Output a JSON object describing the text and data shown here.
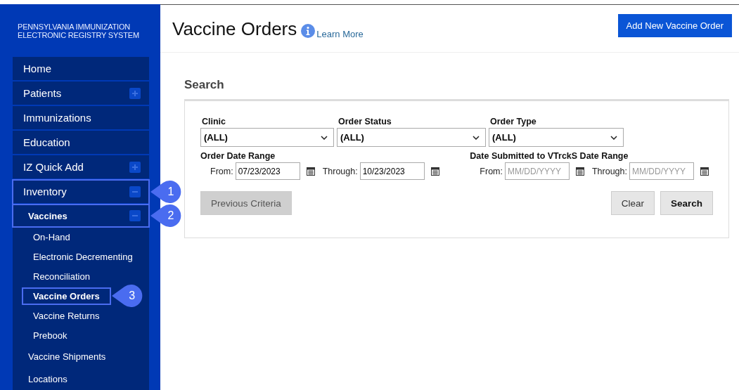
{
  "sidebar": {
    "brand_lines": [
      "PENNSYLVANIA IMMUNIZATION",
      "ELECTRONIC REGISTRY SYSTEM"
    ],
    "items": [
      {
        "label": "Home",
        "kind": "link"
      },
      {
        "label": "Patients",
        "kind": "group",
        "expanded": false
      },
      {
        "label": "Immunizations",
        "kind": "link"
      },
      {
        "label": "Education",
        "kind": "link"
      },
      {
        "label": "IZ Quick Add",
        "kind": "group",
        "expanded": false
      },
      {
        "label": "Inventory",
        "kind": "group",
        "expanded": true,
        "callout": "1",
        "children": [
          {
            "label": "Vaccines",
            "kind": "group",
            "expanded": true,
            "callout": "2",
            "children": [
              {
                "label": "On-Hand",
                "selected": false
              },
              {
                "label": "Electronic Decrementing",
                "selected": false
              },
              {
                "label": "Reconciliation",
                "selected": false
              },
              {
                "label": "Vaccine Orders",
                "selected": true,
                "callout": "3"
              },
              {
                "label": "Vaccine Returns",
                "selected": false
              },
              {
                "label": "Prebook",
                "selected": false
              }
            ]
          },
          {
            "label": "Vaccine Shipments",
            "kind": "link"
          },
          {
            "label": "Locations",
            "kind": "link"
          }
        ]
      }
    ]
  },
  "header": {
    "title": "Vaccine Orders",
    "help_link": "Learn More",
    "add_button": "Add New Vaccine Order"
  },
  "search": {
    "heading": "Search",
    "selects": [
      {
        "label": "Clinic",
        "value": "(ALL)"
      },
      {
        "label": "Order Status",
        "value": "(ALL)"
      },
      {
        "label": "Order Type",
        "value": "(ALL)"
      }
    ],
    "date_ranges": [
      {
        "label": "Order Date Range",
        "fields": [
          {
            "label": "From:",
            "value": "07/23/2023"
          },
          {
            "label": "Through:",
            "value": "10/23/2023"
          }
        ]
      },
      {
        "label": "Date Submitted to VTrckS Date Range",
        "fields": [
          {
            "label": "From:",
            "placeholder": "MM/DD/YYYY"
          },
          {
            "label": "Through:",
            "placeholder": "MM/DD/YYYY"
          }
        ]
      }
    ],
    "previous_button": {
      "label": "Previous Criteria",
      "disabled": true
    },
    "clear_button": "Clear",
    "search_button": "Search"
  }
}
